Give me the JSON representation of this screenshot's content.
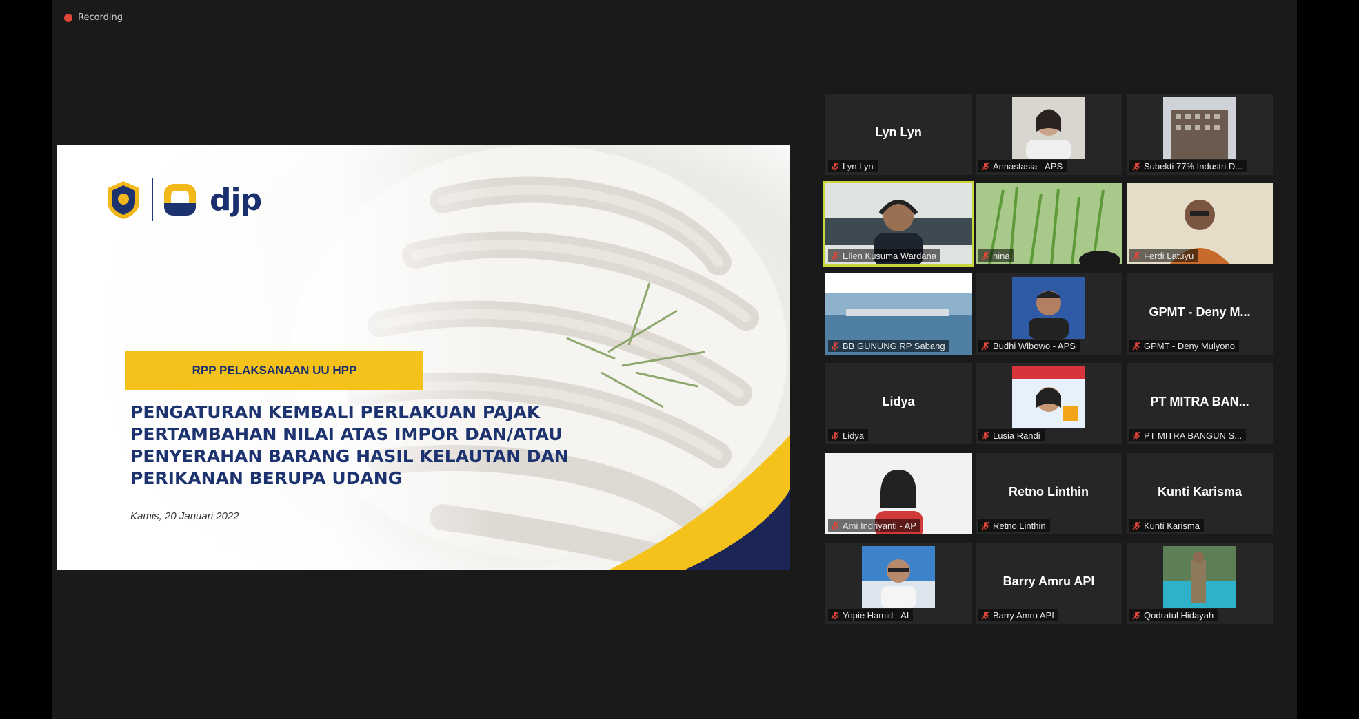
{
  "recording": {
    "label": "Recording"
  },
  "slide": {
    "brand": "djp",
    "tag": "RPP PELAKSANAAN UU HPP",
    "title_lines": [
      "PENGATURAN KEMBALI PERLAKUAN PAJAK",
      "PERTAMBAHAN NILAI ATAS IMPOR DAN/ATAU",
      "PENYERAHAN BARANG HASIL KELAUTAN DAN",
      "PERIKANAN BERUPA UDANG"
    ],
    "date": "Kamis, 20 Januari 2022"
  },
  "participants": [
    {
      "center": "Lyn Lyn",
      "label": "Lyn Lyn"
    },
    {
      "center": "",
      "label": "Annastasia - APS"
    },
    {
      "center": "",
      "label": "Subekti 77% Industri D..."
    },
    {
      "center": "",
      "label": "Ellen Kusuma Wardana"
    },
    {
      "center": "",
      "label": "nina"
    },
    {
      "center": "",
      "label": "Ferdi Latuyu"
    },
    {
      "center": "",
      "label": "BB GUNUNG RP Sabang"
    },
    {
      "center": "",
      "label": "Budhi Wibowo - APS"
    },
    {
      "center": "GPMT - Deny M...",
      "label": "GPMT - Deny Mulyono"
    },
    {
      "center": "Lidya",
      "label": "Lidya"
    },
    {
      "center": "",
      "label": "Lusia Randi"
    },
    {
      "center": "PT MITRA BAN...",
      "label": "PT MITRA BANGUN S..."
    },
    {
      "center": "",
      "label": "Ami Indriyanti - AP"
    },
    {
      "center": "Retno Linthin",
      "label": "Retno Linthin"
    },
    {
      "center": "Kunti Karisma",
      "label": "Kunti Karisma"
    },
    {
      "center": "",
      "label": "Yopie Hamid - AI"
    },
    {
      "center": "Barry Amru API",
      "label": "Barry Amru API"
    },
    {
      "center": "",
      "label": "Qodratul Hidayah"
    }
  ],
  "colors": {
    "active_border": "#c8d63a",
    "mute_icon": "#e0453a",
    "slide_navy": "#1d3370",
    "slide_yellow": "#f4c21a"
  }
}
